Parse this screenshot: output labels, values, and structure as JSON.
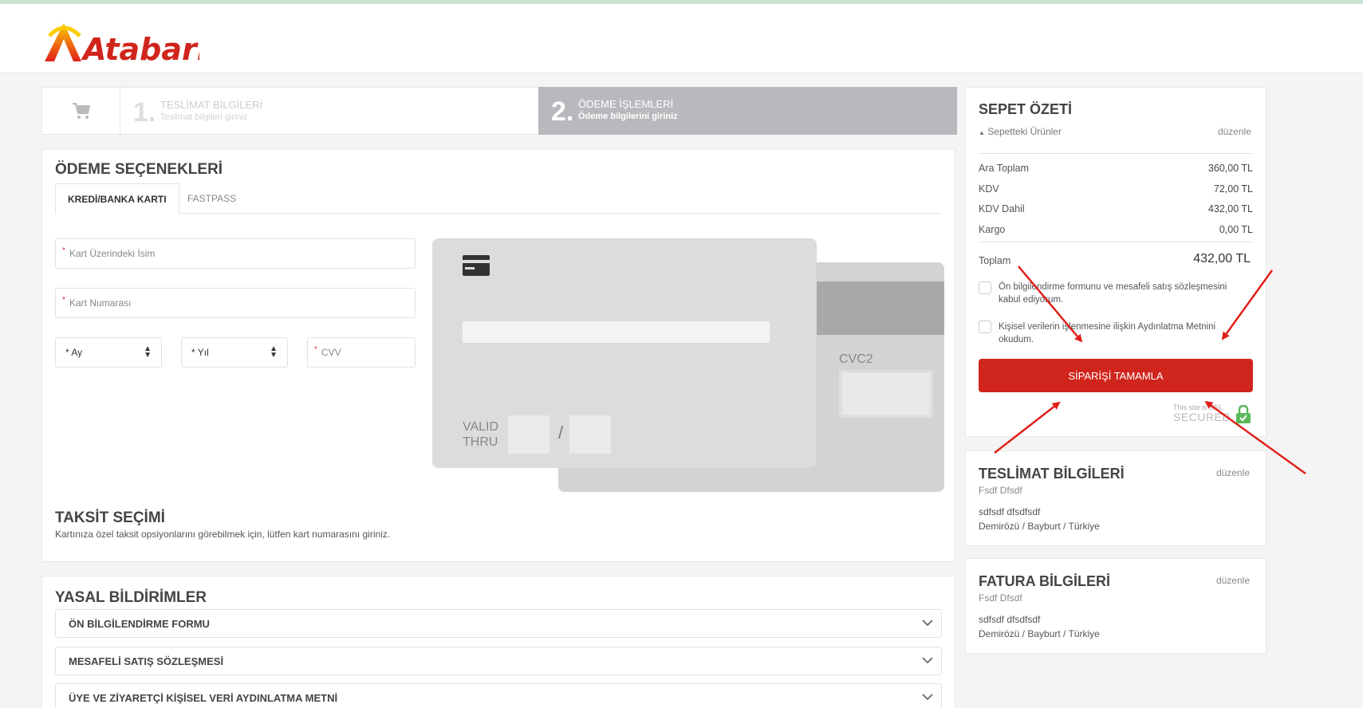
{
  "brand": {
    "logo_text": "Atabarı",
    "accent": "#d0251c"
  },
  "steps": {
    "cart_icon": "cart-icon",
    "step1": {
      "number": "1.",
      "title": "TESLİMAT BİLGİLERİ",
      "subtitle": "Teslimat bilgileri giriniz"
    },
    "step2": {
      "number": "2.",
      "title": "ÖDEME İŞLEMLERİ",
      "subtitle": "Ödeme bilgilerini giriniz"
    }
  },
  "payment": {
    "title": "ÖDEME SEÇENEKLERİ",
    "tabs": [
      {
        "label": "KREDİ/BANKA KARTI"
      },
      {
        "label": "FASTPASS"
      }
    ],
    "fields": {
      "card_name": "Kart Üzerindeki İsim",
      "card_number": "Kart Numarası",
      "month": "* Ay",
      "year": "* Yıl",
      "cvv": "CVV"
    },
    "card_front": {
      "valid": "VALID",
      "thru": "THRU",
      "slash": "/"
    },
    "card_back": {
      "cvc_label": "CVC2"
    },
    "installment": {
      "title": "TAKSİT SEÇİMİ",
      "text": "Kartınıza özel taksit opsiyonlarını görebilmek için, lütfen kart numarasını giriniz."
    }
  },
  "legal": {
    "title": "YASAL BİLDİRİMLER",
    "items": [
      {
        "label": "ÖN BİLGİLENDİRME FORMU"
      },
      {
        "label": "MESAFELİ SATIŞ SÖZLEŞMESİ"
      },
      {
        "label": "ÜYE VE ZİYARETÇİ KİŞİSEL VERİ AYDINLATMA METNİ"
      }
    ]
  },
  "summary": {
    "title": "SEPET ÖZETİ",
    "items_link": "Sepetteki Ürünler",
    "edit": "düzenle",
    "rows": [
      {
        "label": "Ara Toplam",
        "value": "360,00 TL"
      },
      {
        "label": "KDV",
        "value": "72,00 TL"
      },
      {
        "label": "KDV Dahil",
        "value": "432,00 TL"
      },
      {
        "label": "Kargo",
        "value": "0,00 TL"
      }
    ],
    "total": {
      "label": "Toplam",
      "value": "432,00 TL"
    },
    "checks": [
      {
        "text": "Ön bilgilendirme formunu ve mesafeli satış sözleşmesini kabul ediyorum."
      },
      {
        "text": "Kişisel verilerin işlenmesine ilişkin Aydınlatma Metnini okudum."
      }
    ],
    "button": "SİPARİŞİ TAMAMLA",
    "ssl_small": "This site is SSL",
    "ssl_big": "SECURED"
  },
  "delivery": {
    "title": "TESLİMAT BİLGİLERİ",
    "edit": "düzenle",
    "name": "Fsdf Dfsdf",
    "address_line1": "sdfsdf dfsdfsdf",
    "address_line2": "Demirözü / Bayburt / Türkiye"
  },
  "invoice": {
    "title": "FATURA BİLGİLERİ",
    "edit": "düzenle",
    "name": "Fsdf Dfsdf",
    "address_line1": "sdfsdf dfsdfsdf",
    "address_line2": "Demirözü / Bayburt / Türkiye"
  },
  "annotation_color": "#e0201a"
}
